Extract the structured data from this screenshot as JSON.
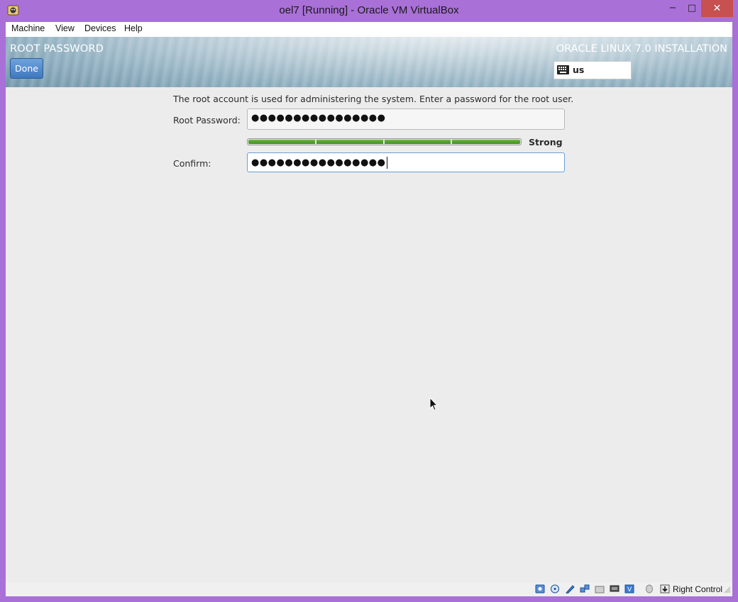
{
  "window": {
    "title": "oel7 [Running] - Oracle VM VirtualBox",
    "minimize": "−",
    "maximize": "□",
    "close": "✕"
  },
  "menu": {
    "items": [
      "Machine",
      "View",
      "Devices",
      "Help"
    ]
  },
  "installer": {
    "spoke_title": "ROOT PASSWORD",
    "done_label": "Done",
    "product_title": "ORACLE LINUX 7.0 INSTALLATION",
    "keyboard_layout": "us",
    "keyboard_icon": "keyboard-icon"
  },
  "form": {
    "intro": "The root account is used for administering the system.  Enter a password for the root user.",
    "root_password_label": "Root Password:",
    "root_password_value": "●●●●●●●●●●●●●●●●",
    "strength_label": "Strong",
    "strength_level": 1.0,
    "confirm_label": "Confirm:",
    "confirm_value": "●●●●●●●●●●●●●●●●"
  },
  "statusbar": {
    "icons": [
      "hard-disk-icon",
      "optical-disk-icon",
      "usb-icon",
      "network-icon",
      "shared-folder-icon",
      "display-icon",
      "video-capture-icon",
      "virtualization-icon",
      "mouse-integration-icon",
      "keyboard-capture-icon"
    ],
    "host_key": "Right Control"
  },
  "colors": {
    "window_frame": "#a970d8",
    "done_button": "#4a84c6",
    "strength_green": "#4fa22a",
    "close_button": "#c75050"
  }
}
